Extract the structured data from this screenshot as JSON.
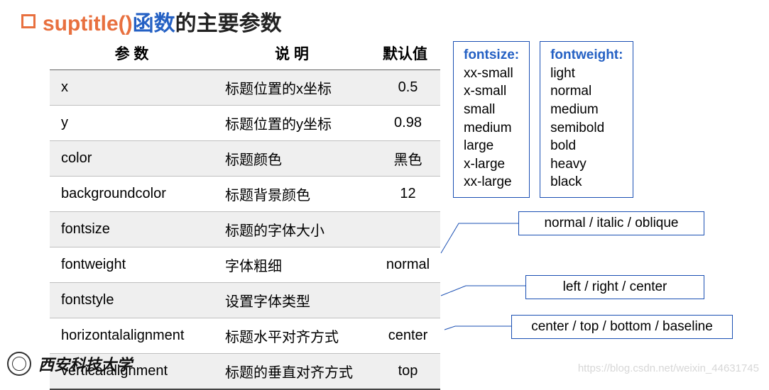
{
  "title": {
    "func_orange": "suptitle()",
    "func_blue": "函数",
    "suffix": "的主要参数"
  },
  "table": {
    "headers": {
      "param": "参 数",
      "desc": "说 明",
      "def": "默认值"
    },
    "rows": [
      {
        "param": "x",
        "desc": "标题位置的x坐标",
        "def": "0.5"
      },
      {
        "param": "y",
        "desc": "标题位置的y坐标",
        "def": "0.98"
      },
      {
        "param": "color",
        "desc": "标题颜色",
        "def": "黑色"
      },
      {
        "param": "backgroundcolor",
        "desc": "标题背景颜色",
        "def": "12"
      },
      {
        "param": "fontsize",
        "desc": "标题的字体大小",
        "def": ""
      },
      {
        "param": "fontweight",
        "desc": "字体粗细",
        "def": "normal"
      },
      {
        "param": "fontstyle",
        "desc": "设置字体类型",
        "def": ""
      },
      {
        "param": "horizontalalignment",
        "desc": "标题水平对齐方式",
        "def": "center"
      },
      {
        "param": "verticalalignment",
        "desc": "标题的垂直对齐方式",
        "def": "top"
      }
    ]
  },
  "fontsize_box": {
    "heading": "fontsize:",
    "values": [
      "xx-small",
      "x-small",
      "small",
      "medium",
      "large",
      "x-large",
      "xx-large"
    ]
  },
  "fontweight_box": {
    "heading": "fontweight:",
    "values": [
      "light",
      "normal",
      "medium",
      "semibold",
      "bold",
      "heavy",
      "black"
    ]
  },
  "callouts": {
    "fontstyle": "normal / italic / oblique",
    "halign": "left / right / center",
    "valign": "center / top / bottom / baseline"
  },
  "footer": {
    "university": "西安科技大学"
  },
  "watermark": "https://blog.csdn.net/weixin_44631745"
}
